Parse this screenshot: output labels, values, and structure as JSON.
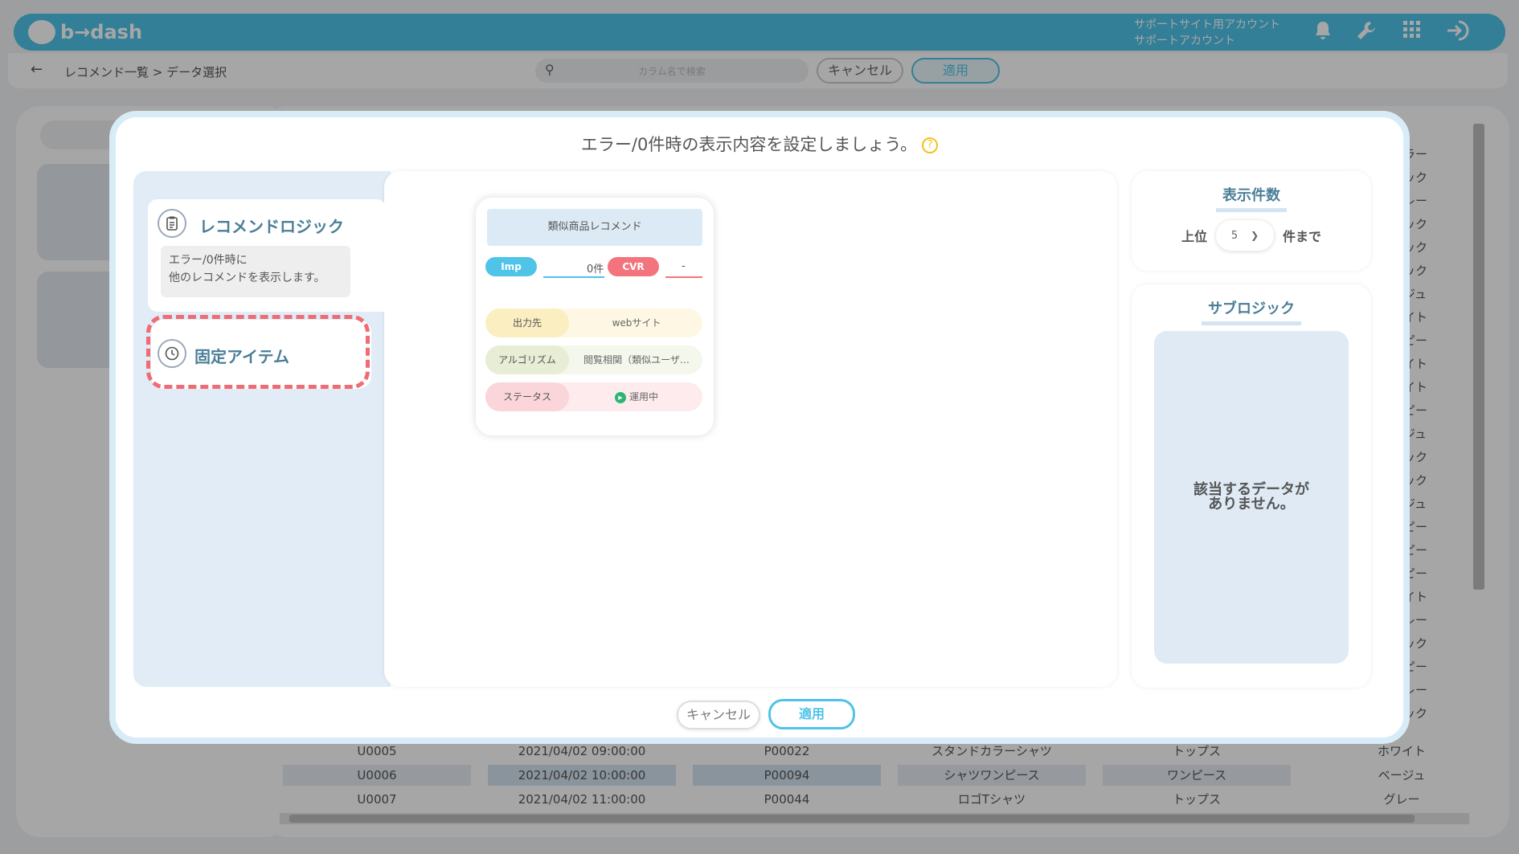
{
  "app": {
    "logo": "b→dash",
    "account_line1": "サポートサイト用アカウント",
    "account_line2": "サポートアカウント"
  },
  "subbar": {
    "breadcrumb": "レコメンド一覧  >  データ選択",
    "search_placeholder": "カラム名で検索",
    "cancel_label": "キャンセル",
    "apply_label": "適用"
  },
  "table": {
    "rows": [
      [
        "U0005",
        "2021/04/02 09:00:00",
        "P00022",
        "スタンドカラーシャツ",
        "トップス",
        "ホワイト"
      ],
      [
        "U0006",
        "2021/04/02 10:00:00",
        "P00094",
        "シャツワンピース",
        "ワンピース",
        "ベージュ"
      ],
      [
        "U0007",
        "2021/04/02 11:00:00",
        "P00044",
        "ロゴTシャツ",
        "トップス",
        "グレー"
      ]
    ],
    "right_column": [
      "ラー",
      "ック",
      "レー",
      "ック",
      "ック",
      "ック",
      "ジュ",
      "イト",
      "ピー",
      "イト",
      "イト",
      "ピー",
      "ジュ",
      "ック",
      "ック",
      "ジュ",
      "ピー",
      "ピー",
      "ピー",
      "イト",
      "レー",
      "ック",
      "ピー",
      "レー",
      "ック"
    ]
  },
  "modal": {
    "title": "エラー/0件時の表示内容を設定しましょう。",
    "help": "?",
    "nav": {
      "logic_label": "レコメンドロジック",
      "logic_desc_1": "エラー/0件時に",
      "logic_desc_2": "他のレコメンドを表示します。",
      "fixed_label": "固定アイテム"
    },
    "card": {
      "title": "類似商品レコメンド",
      "imp_label": "Imp",
      "imp_value": "0件",
      "cvr_label": "CVR",
      "cvr_value": "-",
      "fields": [
        {
          "label": "出力先",
          "value": "webサイト"
        },
        {
          "label": "アルゴリズム",
          "value": "閲覧相関（類似ユーザ…"
        },
        {
          "label": "ステータス",
          "value": "運用中"
        }
      ]
    },
    "count_box": {
      "title": "表示件数",
      "prefix": "上位",
      "value": "5",
      "suffix": "件まで"
    },
    "sublogic": {
      "title": "サブロジック",
      "empty_1": "該当するデータが",
      "empty_2": "ありません。"
    },
    "cancel_label": "キャンセル",
    "apply_label": "適用"
  },
  "colors": {
    "accent": "#4fc3e8",
    "imp": "#4fc3e8",
    "cvr": "#f3747c",
    "highlight_dash": "#f06b73",
    "status_running": "#2bb673"
  }
}
